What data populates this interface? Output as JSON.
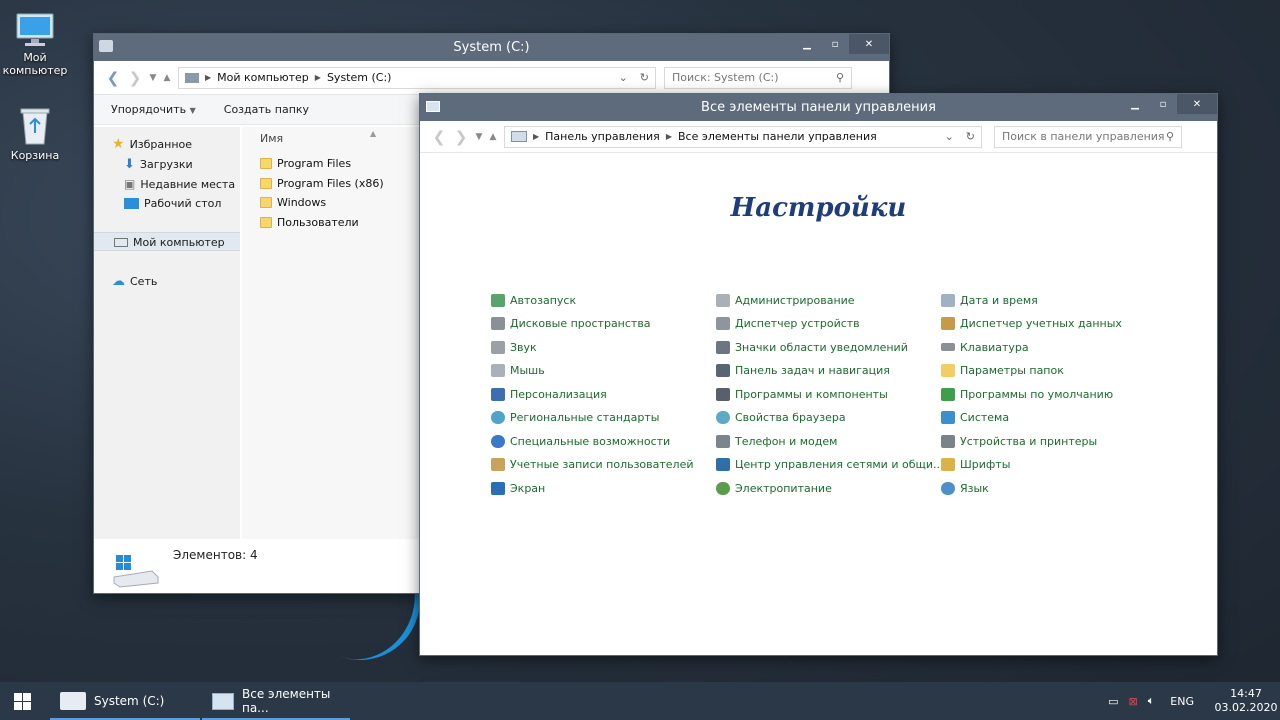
{
  "desktop": {
    "icons": [
      {
        "label": "Мой компьютер",
        "icon": "computer-icon"
      },
      {
        "label": "Корзина",
        "icon": "recycle-bin-icon"
      }
    ]
  },
  "explorer": {
    "title": "System (C:)",
    "address": {
      "root": "Мой компьютер",
      "current": "System (C:)"
    },
    "search_placeholder": "Поиск: System (C:)",
    "toolbar": {
      "organize": "Упорядочить",
      "new_folder": "Создать папку"
    },
    "nav": {
      "favorites": "Избранное",
      "downloads": "Загрузки",
      "recent": "Недавние места",
      "desktop": "Рабочий стол",
      "computer": "Мой компьютер",
      "network": "Сеть"
    },
    "column_name": "Имя",
    "files": [
      "Program Files",
      "Program Files (x86)",
      "Windows",
      "Пользователи"
    ],
    "status": "Элементов: 4"
  },
  "control_panel": {
    "title": "Все элементы панели управления",
    "address": {
      "root": "Панель управления",
      "current": "Все элементы панели управления"
    },
    "search_placeholder": "Поиск в панели управления",
    "heading": "Настройки",
    "columns": [
      [
        "Автозапуск",
        "Дисковые пространства",
        "Звук",
        "Мышь",
        "Персонализация",
        "Региональные стандарты",
        "Специальные возможности",
        "Учетные записи пользователей",
        "Экран"
      ],
      [
        "Администрирование",
        "Диспетчер устройств",
        "Значки области уведомлений",
        "Панель задач и навигация",
        "Программы и компоненты",
        "Свойства браузера",
        "Телефон и модем",
        "Центр управления сетями и общи...",
        "Электропитание"
      ],
      [
        "Дата и время",
        "Диспетчер учетных данных",
        "Клавиатура",
        "Параметры папок",
        "Программы по умолчанию",
        "Система",
        "Устройства и принтеры",
        "Шрифты",
        "Язык"
      ]
    ]
  },
  "taskbar": {
    "items": [
      "System (C:)",
      "Все элементы па..."
    ],
    "language": "ENG",
    "time": "14:47",
    "date": "03.02.2020"
  },
  "colors": {
    "titlebar": "#5d6b7c",
    "taskbar": "#2b3848",
    "link": "#1d6b2f",
    "heading": "#1f3d7a"
  }
}
